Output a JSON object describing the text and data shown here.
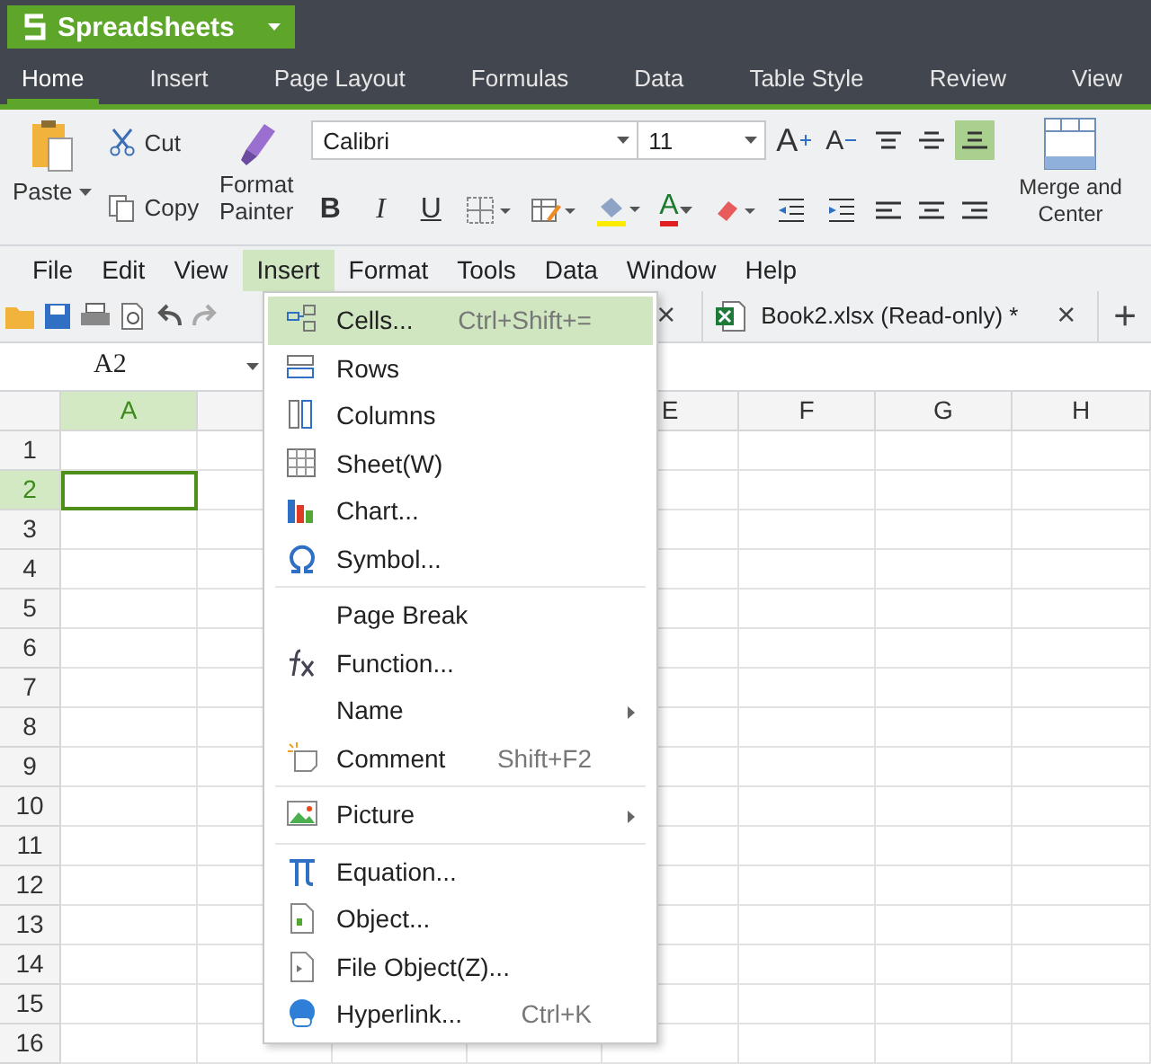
{
  "app": {
    "title": "Spreadsheets"
  },
  "ribbon_tabs": [
    {
      "label": "Home",
      "selected": true
    },
    {
      "label": "Insert",
      "selected": false
    },
    {
      "label": "Page Layout",
      "selected": false
    },
    {
      "label": "Formulas",
      "selected": false
    },
    {
      "label": "Data",
      "selected": false
    },
    {
      "label": "Table Style",
      "selected": false
    },
    {
      "label": "Review",
      "selected": false
    },
    {
      "label": "View",
      "selected": false
    }
  ],
  "ribbon": {
    "paste": "Paste",
    "cut": "Cut",
    "copy": "Copy",
    "format_painter": "Format Painter",
    "font": "Calibri",
    "font_size": "11",
    "grow_font": "A",
    "shrink_font": "A",
    "bold": "B",
    "italic": "I",
    "underline": "U",
    "font_color": "A",
    "merge": "Merge and Center",
    "align_buttons": [
      {
        "kind": "top",
        "selected": false
      },
      {
        "kind": "middle",
        "selected": false
      },
      {
        "kind": "bottom",
        "selected": true
      }
    ]
  },
  "menu_bar": [
    {
      "label": "File",
      "selected": false
    },
    {
      "label": "Edit",
      "selected": false
    },
    {
      "label": "View",
      "selected": false
    },
    {
      "label": "Insert",
      "selected": true
    },
    {
      "label": "Format",
      "selected": false
    },
    {
      "label": "Tools",
      "selected": false
    },
    {
      "label": "Data",
      "selected": false
    },
    {
      "label": "Window",
      "selected": false
    },
    {
      "label": "Help",
      "selected": false
    }
  ],
  "doc_tabs": [
    {
      "close": "×"
    },
    {
      "label": "Book2.xlsx (Read-only) *",
      "close": "×"
    }
  ],
  "new_tab": "+",
  "name_box": "A2",
  "sheet": {
    "columns": [
      {
        "label": "A",
        "selected": true
      },
      {
        "selected": false
      },
      {},
      {},
      {
        "label": "E",
        "selected": false
      },
      {
        "label": "F",
        "selected": false
      },
      {
        "label": "G",
        "selected": false
      },
      {
        "label": "H",
        "selected": false
      }
    ],
    "rows": [
      {
        "label": "1",
        "selected": false
      },
      {
        "label": "2",
        "selected": true
      },
      {
        "label": "3",
        "selected": false
      },
      {
        "label": "4",
        "selected": false
      },
      {
        "label": "5",
        "selected": false
      },
      {
        "label": "6",
        "selected": false
      },
      {
        "label": "7",
        "selected": false
      },
      {
        "label": "8",
        "selected": false
      },
      {
        "label": "9",
        "selected": false
      },
      {
        "label": "10",
        "selected": false
      },
      {
        "label": "11",
        "selected": false
      },
      {
        "label": "12",
        "selected": false
      },
      {
        "label": "13",
        "selected": false
      },
      {
        "label": "14",
        "selected": false
      },
      {
        "label": "15",
        "selected": false
      },
      {
        "label": "16",
        "selected": false
      }
    ]
  },
  "insert_menu": {
    "sections": [
      [
        {
          "kind": "cells",
          "label": "Cells...",
          "shortcut": "Ctrl+Shift+=",
          "selected": true
        },
        {
          "kind": "rows",
          "label": "Rows",
          "selected": false
        },
        {
          "kind": "columns",
          "label": "Columns",
          "selected": false
        },
        {
          "kind": "sheet",
          "label": "Sheet(W)",
          "selected": false
        },
        {
          "kind": "chart",
          "label": "Chart...",
          "selected": false
        },
        {
          "kind": "symbol",
          "label": "Symbol...",
          "selected": false
        }
      ],
      [
        {
          "kind": "plain",
          "label": "Page Break",
          "selected": false
        },
        {
          "kind": "function",
          "label": "Function...",
          "selected": false
        },
        {
          "kind": "plain",
          "label": "Name",
          "submenu": true,
          "selected": false
        },
        {
          "kind": "comment",
          "label": "Comment",
          "shortcut": "Shift+F2",
          "selected": false
        }
      ],
      [
        {
          "kind": "picture",
          "label": "Picture",
          "submenu": true,
          "selected": false
        }
      ],
      [
        {
          "kind": "equation",
          "label": "Equation...",
          "selected": false
        },
        {
          "kind": "object",
          "label": "Object...",
          "selected": false
        },
        {
          "kind": "file-object",
          "label": "File Object(Z)...",
          "selected": false
        },
        {
          "kind": "hyperlink",
          "label": "Hyperlink...",
          "shortcut": "Ctrl+K",
          "selected": false
        }
      ]
    ]
  }
}
